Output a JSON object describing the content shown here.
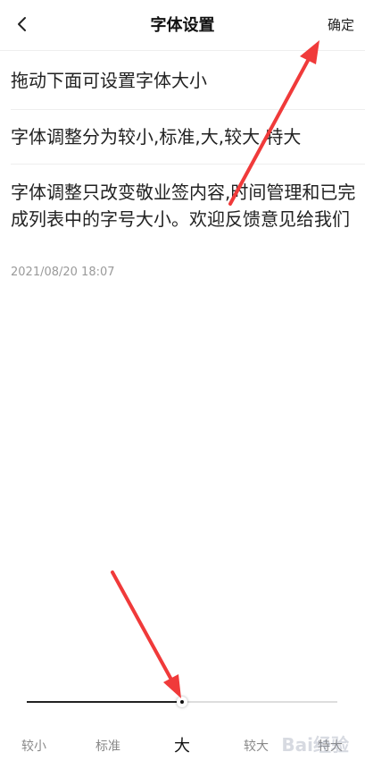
{
  "header": {
    "title": "字体设置",
    "confirm_label": "确定"
  },
  "preview": {
    "line1": "拖动下面可设置字体大小",
    "line2": "字体调整分为较小,标准,大,较大,特大",
    "note": "字体调整只改变敬业签内容,时间管理和已完成列表中的字号大小。欢迎反馈意见给我们",
    "timestamp": "2021/08/20 18:07"
  },
  "slider": {
    "options": [
      "较小",
      "标准",
      "大",
      "较大",
      "特大"
    ],
    "selected_index": 2,
    "selected_label": "大"
  },
  "colors": {
    "annotation_arrow": "#f03a3a",
    "text": "#222222",
    "muted": "#9a9a9a"
  },
  "watermark": "Bai经验"
}
